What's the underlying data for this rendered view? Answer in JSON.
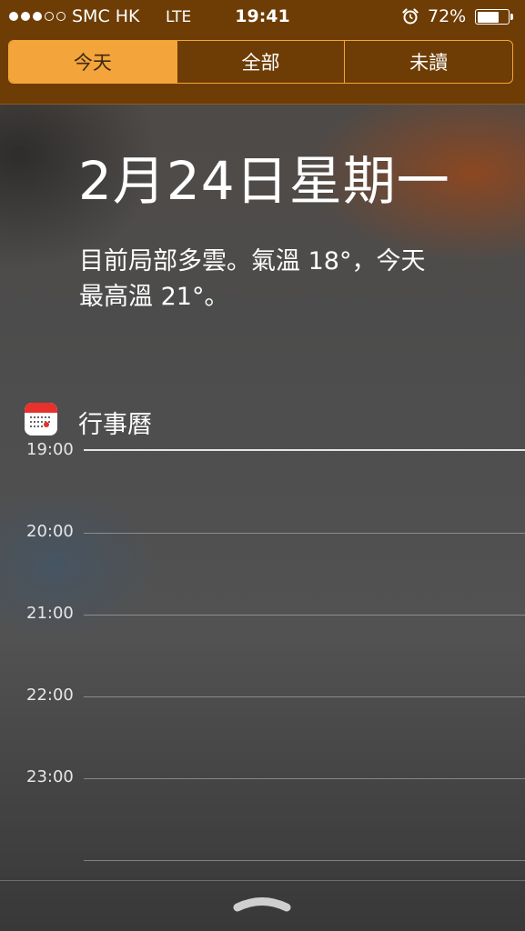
{
  "status_bar": {
    "signal_dots": [
      true,
      true,
      true,
      false,
      false
    ],
    "carrier": "SMC HK",
    "network": "LTE",
    "time": "19:41",
    "alarm_icon": "alarm-clock-icon",
    "battery_percent_text": "72%",
    "battery_level": 0.72
  },
  "tabs": [
    {
      "label": "今天",
      "active": true
    },
    {
      "label": "全部",
      "active": false
    },
    {
      "label": "未讀",
      "active": false
    }
  ],
  "today": {
    "date": "2月24日星期一",
    "weather_line1": "目前局部多雲。氣溫 18°，今天",
    "weather_line2": "最高溫 21°。"
  },
  "calendar": {
    "title": "行事曆",
    "icon": "calendar-app-icon",
    "hours": [
      "19:00",
      "20:00",
      "21:00",
      "22:00",
      "23:00"
    ]
  },
  "footer": {
    "grabber_icon": "chevron-up-grabber-icon"
  },
  "colors": {
    "accent": "#f3a43a",
    "top_bar": "#6e3d05"
  }
}
